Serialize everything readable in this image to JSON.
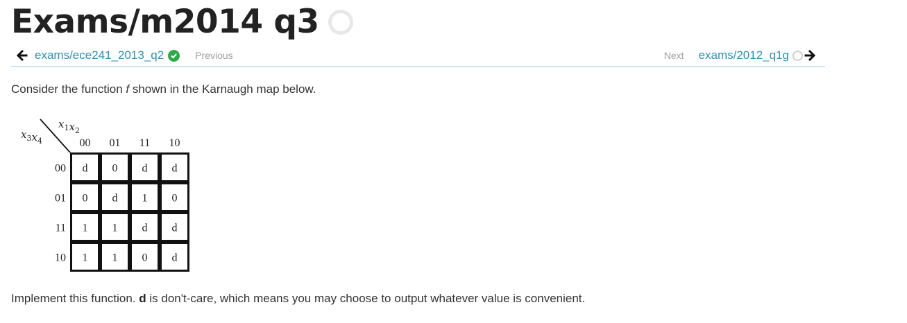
{
  "page": {
    "title": "Exams/m2014 q3"
  },
  "nav": {
    "prev_link": "exams/ece241_2013_q2",
    "prev_hint": "Previous",
    "next_hint": "Next",
    "next_link": "exams/2012_q1g"
  },
  "content": {
    "intro_before": "Consider the function ",
    "intro_var": "f",
    "intro_after": " shown in the Karnaugh map below.",
    "outro_before": "Implement this function. ",
    "outro_bold": "d",
    "outro_after": " is don't-care, which means you may choose to output whatever value is convenient."
  },
  "kmap": {
    "col_var": "x1x2",
    "row_var": "x3x4",
    "col_headers": [
      "00",
      "01",
      "11",
      "10"
    ],
    "row_headers": [
      "00",
      "01",
      "11",
      "10"
    ],
    "cells": [
      [
        "d",
        "0",
        "d",
        "d"
      ],
      [
        "0",
        "d",
        "1",
        "0"
      ],
      [
        "1",
        "1",
        "d",
        "d"
      ],
      [
        "1",
        "1",
        "0",
        "d"
      ]
    ]
  },
  "icons": {
    "back": "arrow-left-icon",
    "prev_status": "check-circle-icon",
    "title_status": "empty-circle-icon",
    "next_status": "empty-circle-icon",
    "forward": "arrow-right-icon"
  },
  "colors": {
    "link": "#2a91b8",
    "check": "#2eaa4a",
    "divider": "#c9e6f2"
  }
}
